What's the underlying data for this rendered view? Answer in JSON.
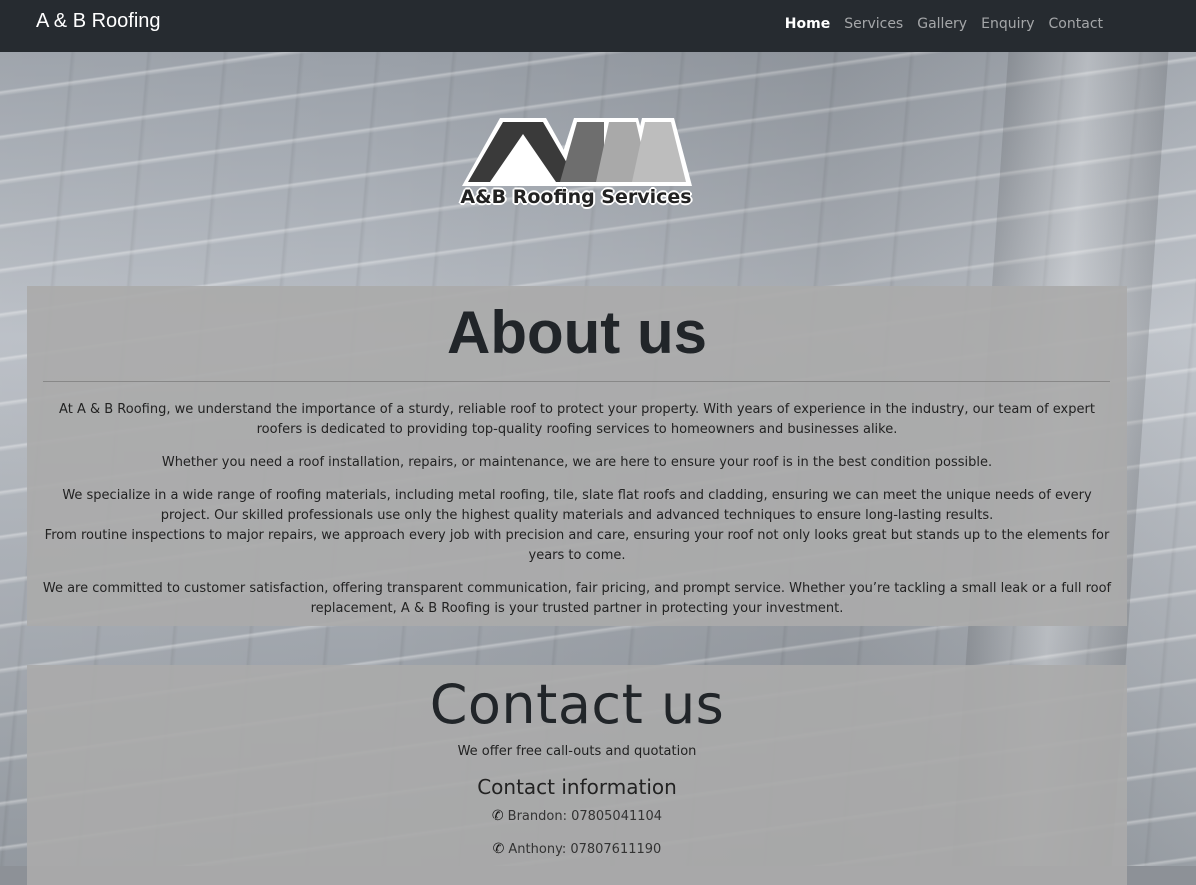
{
  "navbar": {
    "brand": "A & B Roofing",
    "links": [
      {
        "label": "Home",
        "active": true
      },
      {
        "label": "Services",
        "active": false
      },
      {
        "label": "Gallery",
        "active": false
      },
      {
        "label": "Enquiry",
        "active": false
      },
      {
        "label": "Contact",
        "active": false
      }
    ]
  },
  "logo": {
    "text": "A&B Roofing Services",
    "colors": {
      "dark": "#3a3a3a",
      "mid": "#6e6e6e",
      "light": "#a9a9a9"
    }
  },
  "about": {
    "title": "About us",
    "paragraphs": [
      "At A & B Roofing, we understand the importance of a sturdy, reliable roof to protect your property. With years of experience in the industry, our team of expert roofers is dedicated to providing top-quality roofing services to homeowners and businesses alike.",
      "Whether you need a roof installation, repairs, or maintenance, we are here to ensure your roof is in the best condition possible.",
      "We specialize in a wide range of roofing materials, including metal roofing, tile, slate flat roofs and cladding, ensuring we can meet the unique needs of every project. Our skilled professionals use only the highest quality materials and advanced techniques to ensure long-lasting results.",
      "From routine inspections to major repairs, we approach every job with precision and care, ensuring your roof not only looks great but stands up to the elements for years to come.",
      "We are committed to customer satisfaction, offering transparent communication, fair pricing, and prompt service. Whether you’re tackling a small leak or a full roof replacement, A & B Roofing is your trusted partner in protecting your investment."
    ]
  },
  "contact": {
    "title": "Contact us",
    "subtitle": "We offer free call-outs and quotation",
    "info_heading": "Contact information",
    "phones": [
      {
        "label": "Brandon: 07805041104",
        "icon": "phone-icon"
      },
      {
        "label": "Anthony: 07807611190",
        "icon": "phone-icon"
      }
    ]
  },
  "colors": {
    "navbar_bg": "#262b30",
    "panel_bg": "#aaaaaa"
  }
}
